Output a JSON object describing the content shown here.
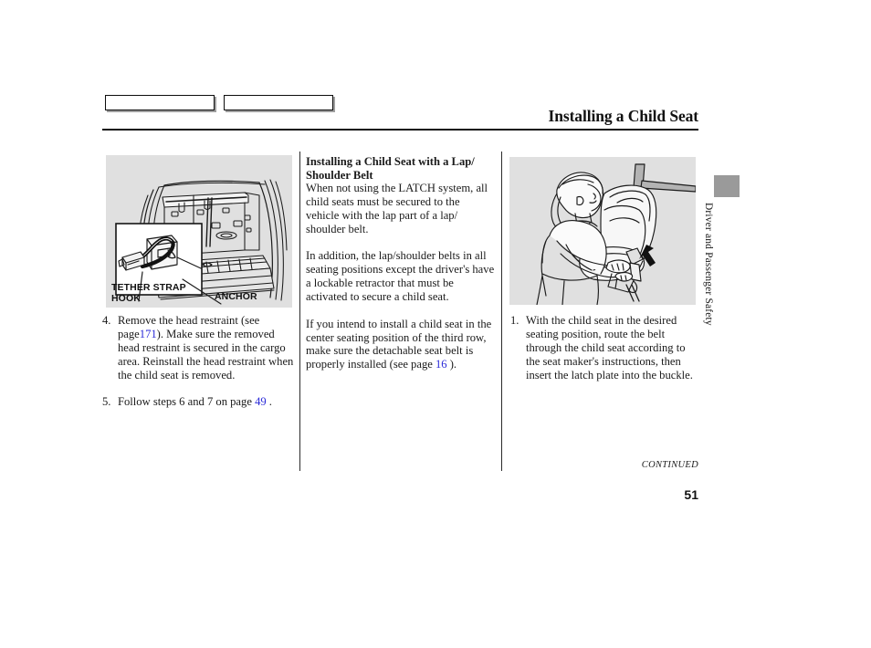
{
  "header": {
    "title": "Installing a Child Seat",
    "boxes": [
      "",
      ""
    ]
  },
  "side_tab": {
    "label": "Driver and Passenger Safety",
    "block_color": "#9a9a9a"
  },
  "left_column": {
    "illustration": {
      "name": "cargo-area-tether-anchor-illustration",
      "background": "#e0e0e0",
      "callouts": {
        "tether_strap_hook": "TETHER STRAP\nHOOK",
        "anchor": "ANCHOR"
      }
    },
    "steps": [
      {
        "number": "4.",
        "text_before": "Remove the head restraint (see page",
        "ref": "171",
        "text_after": "). Make sure the removed head restraint is secured in the cargo area. Reinstall the head restraint when the child seat is removed."
      },
      {
        "number": "5.",
        "text_before": "Follow steps 6 and 7 on page ",
        "ref": "49",
        "text_after": " ."
      }
    ]
  },
  "middle_column": {
    "heading": "Installing a Child Seat with a Lap/ Shoulder Belt",
    "paragraphs": [
      "When not using the LATCH system, all child seats must be secured to the vehicle with the lap part of a lap/ shoulder belt.",
      "In addition, the lap/shoulder belts in all seating positions except the driver's have a lockable retractor that must be activated to secure a child seat."
    ],
    "paragraph_with_ref": {
      "text_before": "If you intend to install a child seat in the center seating position of the third row, make sure the detachable seat belt is properly installed (see page ",
      "ref": "16",
      "text_after": " )."
    }
  },
  "right_column": {
    "illustration": {
      "name": "person-installing-child-seat-illustration",
      "background": "#e0e0e0"
    },
    "steps": [
      {
        "number": "1.",
        "text": "With the child seat in the desired seating position, route the belt through the child seat according to the seat maker's instructions, then insert the latch plate into the buckle."
      }
    ]
  },
  "footer": {
    "continued": "CONTINUED",
    "page_number": "51"
  },
  "colors": {
    "page_reference_link": "#2b2bd8",
    "illustration_background": "#e0e0e0",
    "rule": "#111111"
  }
}
